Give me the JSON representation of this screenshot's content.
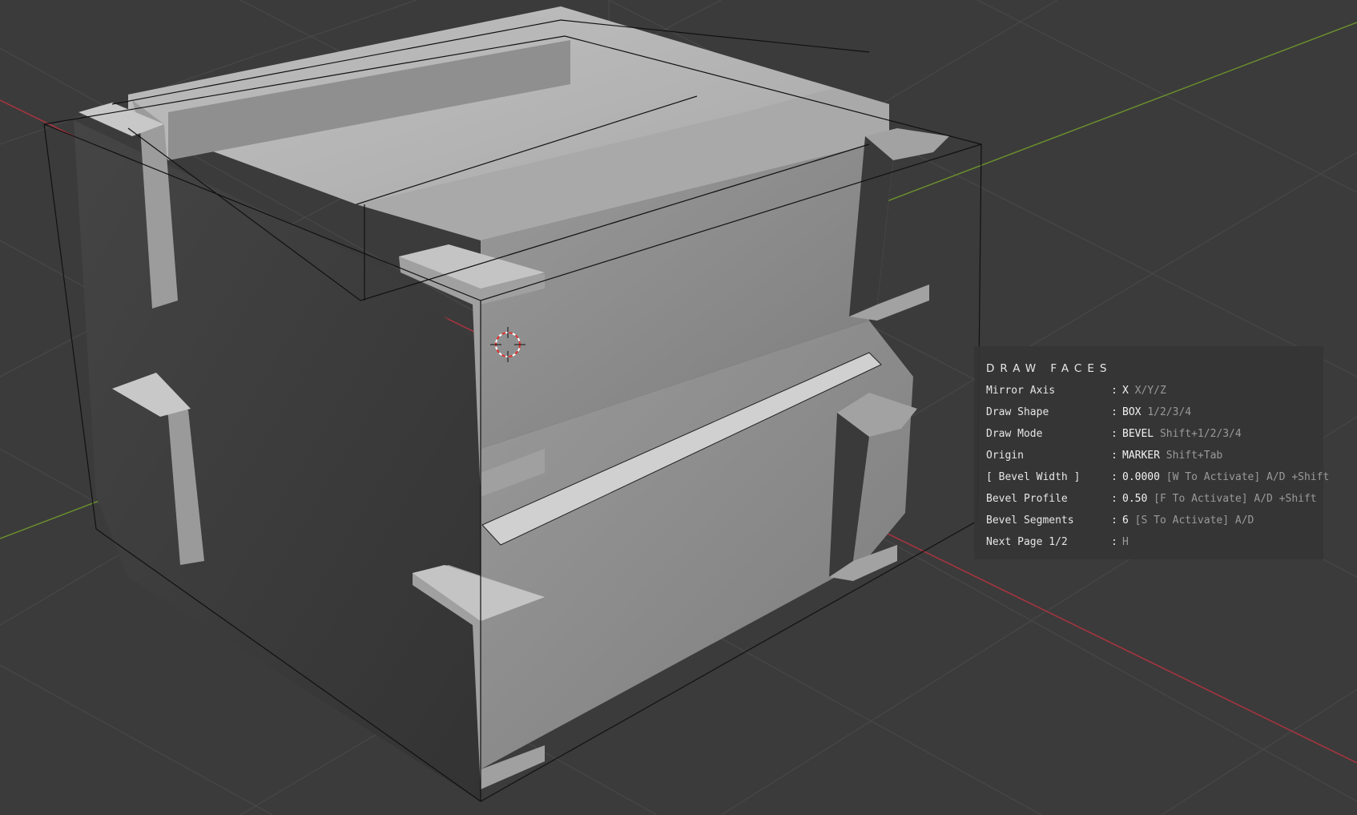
{
  "hud": {
    "title": "DRAW FACES",
    "rows": [
      {
        "label": "Mirror Axis",
        "sep": ":",
        "value": "X",
        "hint": "X/Y/Z"
      },
      {
        "label": "Draw Shape",
        "sep": ":",
        "value": "BOX",
        "hint": "1/2/3/4"
      },
      {
        "label": "Draw Mode",
        "sep": ":",
        "value": "BEVEL",
        "hint": "Shift+1/2/3/4"
      },
      {
        "label": "Origin",
        "sep": ":",
        "value": "MARKER",
        "hint": "Shift+Tab"
      },
      {
        "label": "[ Bevel Width ]",
        "sep": ":",
        "value": "0.0000",
        "hint": "[W To Activate] A/D +Shift"
      },
      {
        "label": "Bevel Profile",
        "sep": ":",
        "value": "0.50",
        "hint": "[F To Activate] A/D +Shift"
      },
      {
        "label": "Bevel Segments",
        "sep": ":",
        "value": "6",
        "hint": "[S To Activate] A/D"
      },
      {
        "label": "Next Page 1/2",
        "sep": ":",
        "value": "",
        "hint": "H"
      }
    ]
  },
  "viewport": {
    "colors": {
      "background": "#3b3b3b",
      "grid": "#4a4a4a",
      "x_axis": "#a8343f",
      "y_axis": "#6a8e2e",
      "bounds_wire": "#111111",
      "cursor_red": "#e03030",
      "cursor_white": "#ffffff"
    },
    "cursor_icon": "3d-cursor-icon"
  }
}
